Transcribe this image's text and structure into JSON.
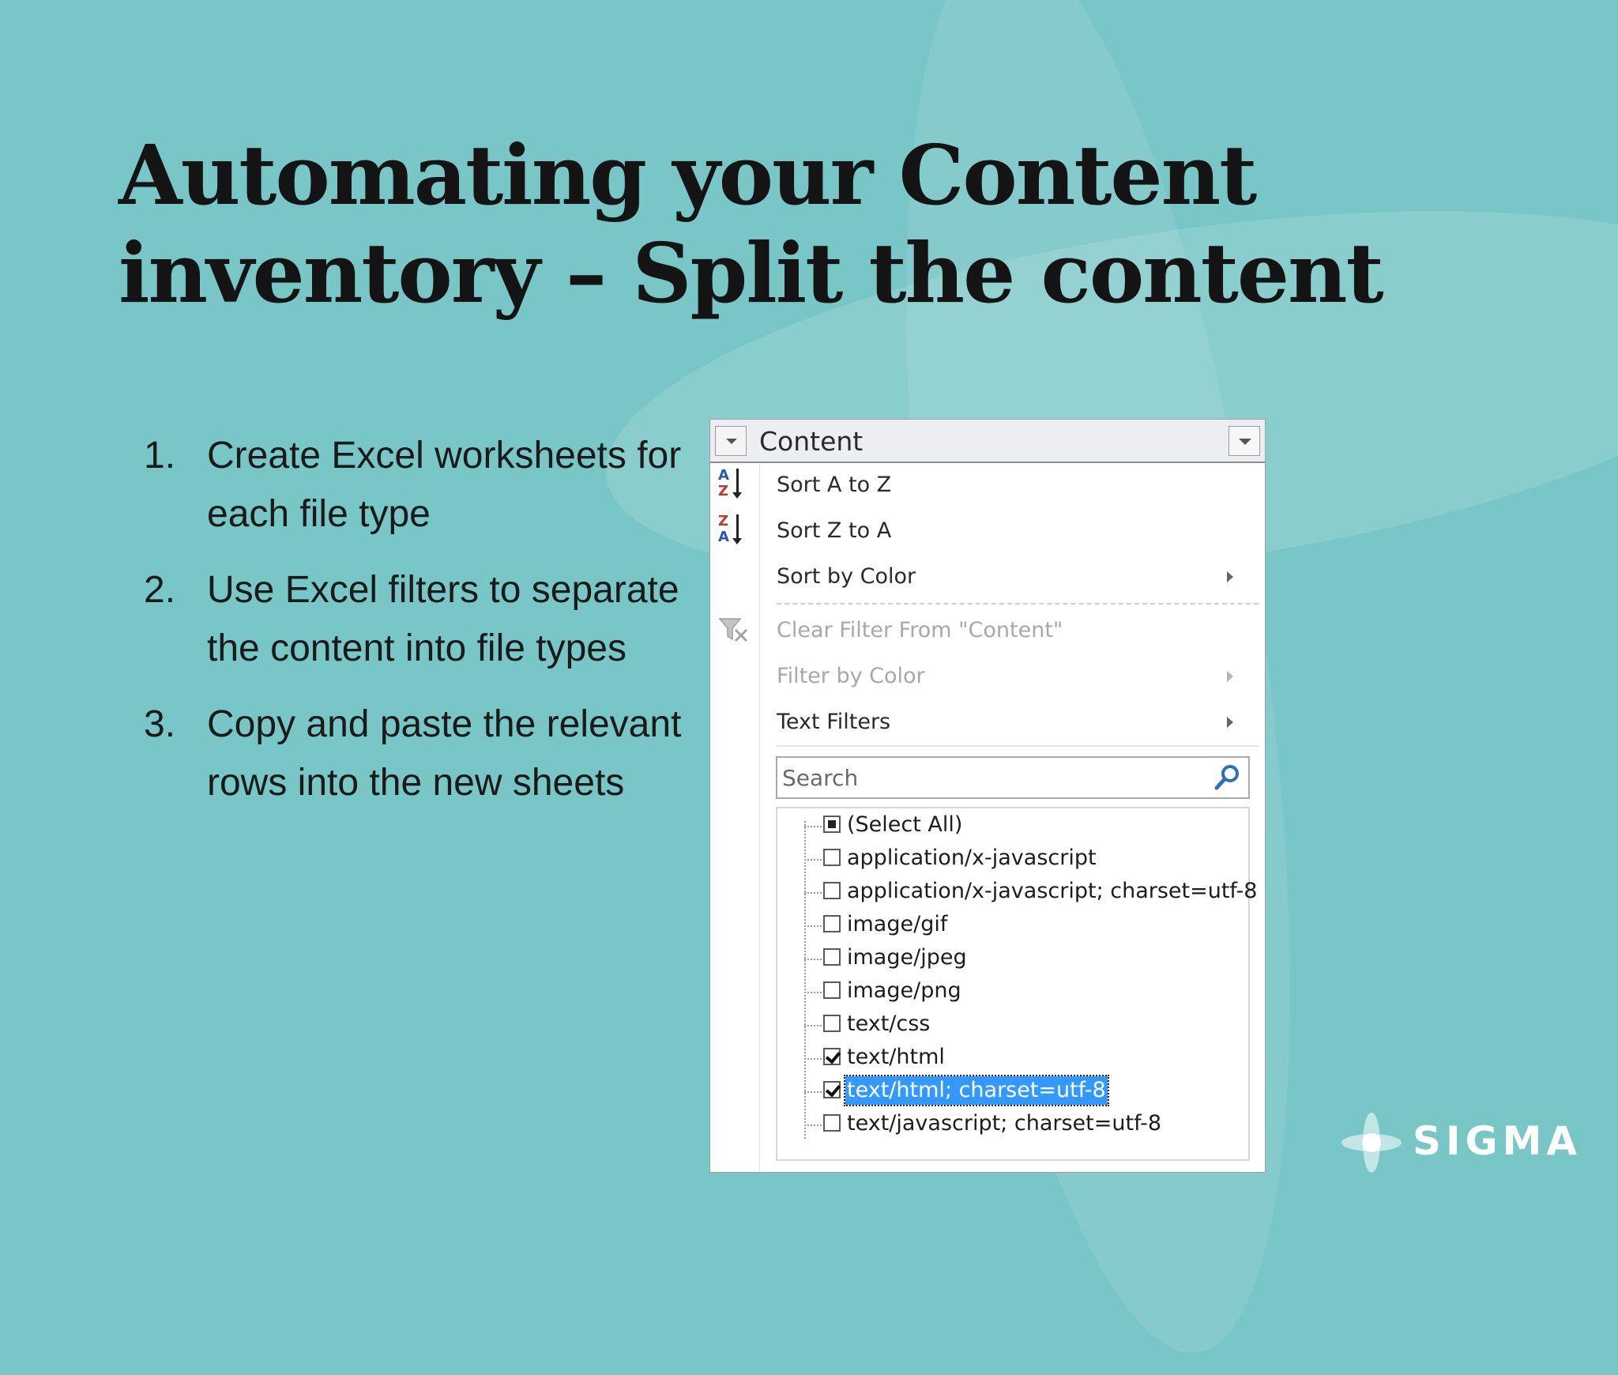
{
  "slide": {
    "title_line1": "Automating your Content",
    "title_line2": "inventory – Split the content",
    "steps": [
      {
        "num": "1.",
        "text": "Create Excel worksheets for each file type"
      },
      {
        "num": "2.",
        "text": "Use Excel filters to separate the content into file types"
      },
      {
        "num": "3.",
        "text": "Copy and paste the relevant rows into the new sheets"
      }
    ],
    "logo_text": "SIGMA"
  },
  "filter_panel": {
    "header_title": "Content",
    "menu": {
      "sort_a_z": "Sort A to Z",
      "sort_z_a": "Sort Z to A",
      "sort_by_color": "Sort by Color",
      "clear_filter": "Clear Filter From \"Content\"",
      "filter_by_color": "Filter by Color",
      "text_filters": "Text Filters"
    },
    "search": {
      "placeholder": "Search"
    },
    "values": [
      {
        "label": "(Select All)",
        "state": "partial",
        "selected": false
      },
      {
        "label": "application/x-javascript",
        "state": "unchecked",
        "selected": false
      },
      {
        "label": "application/x-javascript; charset=utf-8",
        "state": "unchecked",
        "selected": false
      },
      {
        "label": "image/gif",
        "state": "unchecked",
        "selected": false
      },
      {
        "label": "image/jpeg",
        "state": "unchecked",
        "selected": false
      },
      {
        "label": "image/png",
        "state": "unchecked",
        "selected": false
      },
      {
        "label": "text/css",
        "state": "unchecked",
        "selected": false
      },
      {
        "label": "text/html",
        "state": "checked",
        "selected": false
      },
      {
        "label": "text/html; charset=utf-8",
        "state": "checked",
        "selected": true
      },
      {
        "label": "text/javascript; charset=utf-8",
        "state": "unchecked",
        "selected": false
      }
    ]
  },
  "colors": {
    "background": "#79c6c6",
    "selection": "#3399ff",
    "title_text": "#141414"
  }
}
